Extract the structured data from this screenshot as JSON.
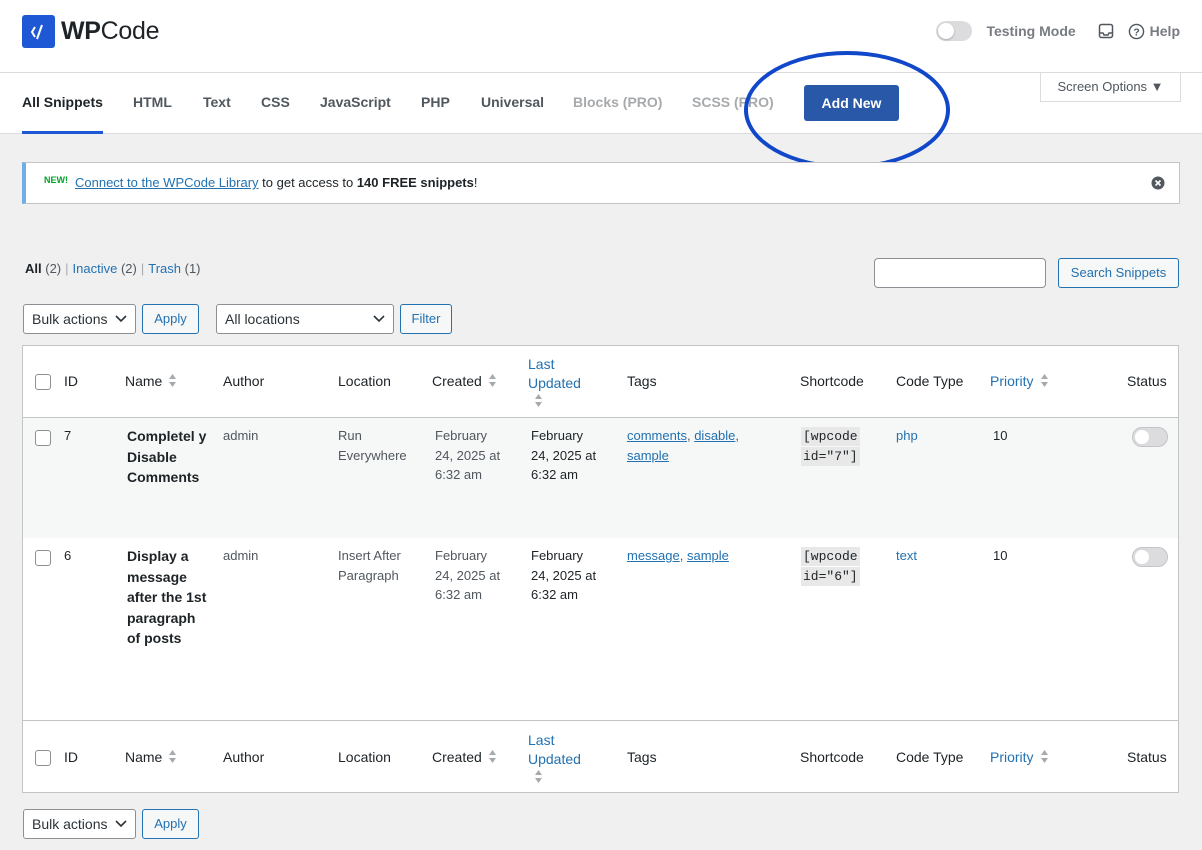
{
  "app": {
    "brand_bold": "WP",
    "brand_rest": "Code",
    "testing_mode_label": "Testing Mode",
    "help_label": "Help"
  },
  "tabs": [
    {
      "label": "All Snippets",
      "active": true
    },
    {
      "label": "HTML"
    },
    {
      "label": "Text"
    },
    {
      "label": "CSS"
    },
    {
      "label": "JavaScript"
    },
    {
      "label": "PHP"
    },
    {
      "label": "Universal"
    },
    {
      "label": "Blocks (PRO)",
      "pro": true
    },
    {
      "label": "SCSS (PRO)",
      "pro": true
    }
  ],
  "add_new_label": "Add New",
  "screen_options_label": "Screen Options ▼",
  "notice": {
    "badge": "NEW!",
    "link": "Connect to the WPCode Library",
    "text_before_bold": " to get access to ",
    "bold": "140 FREE snippets",
    "text_end": "!"
  },
  "views": {
    "all": "All",
    "all_count": "(2)",
    "inactive": "Inactive",
    "inactive_count": "(2)",
    "trash": "Trash",
    "trash_count": "(1)",
    "sep": "|"
  },
  "search": {
    "button": "Search Snippets",
    "placeholder": ""
  },
  "bulk": {
    "select": "Bulk actions",
    "apply": "Apply"
  },
  "location_filter": {
    "select": "All locations",
    "filter": "Filter"
  },
  "columns": {
    "id": "ID",
    "name": "Name",
    "author": "Author",
    "location": "Location",
    "created": "Created",
    "last_updated_1": "Last",
    "last_updated_2": "Updated",
    "tags": "Tags",
    "shortcode": "Shortcode",
    "code_type": "Code Type",
    "priority": "Priority",
    "status": "Status"
  },
  "rows": [
    {
      "id": "7",
      "name": "Completel y Disable Comments",
      "author": "admin",
      "location_1": "Run",
      "location_2": "Everywhere",
      "created_1": "February",
      "created_2": "24, 2025 at",
      "created_3": "6:32 am",
      "updated_1": "February",
      "updated_2": "24, 2025 at",
      "updated_3": "6:32 am",
      "tags": [
        "comments",
        "disable",
        "sample"
      ],
      "shortcode_1": "[wpcode",
      "shortcode_2": "id=\"7\"]",
      "code_type": "php",
      "priority": "10",
      "status": "inactive"
    },
    {
      "id": "6",
      "name": "Display a message after the 1st paragraph of posts",
      "author": "admin",
      "location_1": "Insert After",
      "location_2": "Paragraph",
      "created_1": "February",
      "created_2": "24, 2025 at",
      "created_3": "6:32 am",
      "updated_1": "February",
      "updated_2": "24, 2025 at",
      "updated_3": "6:32 am",
      "tags": [
        "message",
        "sample"
      ],
      "shortcode_1": "[wpcode",
      "shortcode_2": "id=\"6\"]",
      "code_type": "text",
      "priority": "10",
      "status": "inactive"
    }
  ],
  "colors": {
    "brand": "#1e58d4",
    "add_new_bg": "#2958a8",
    "link": "#2271b1",
    "highlight_circle": "#1048c9",
    "new_badge": "#00a32a"
  }
}
